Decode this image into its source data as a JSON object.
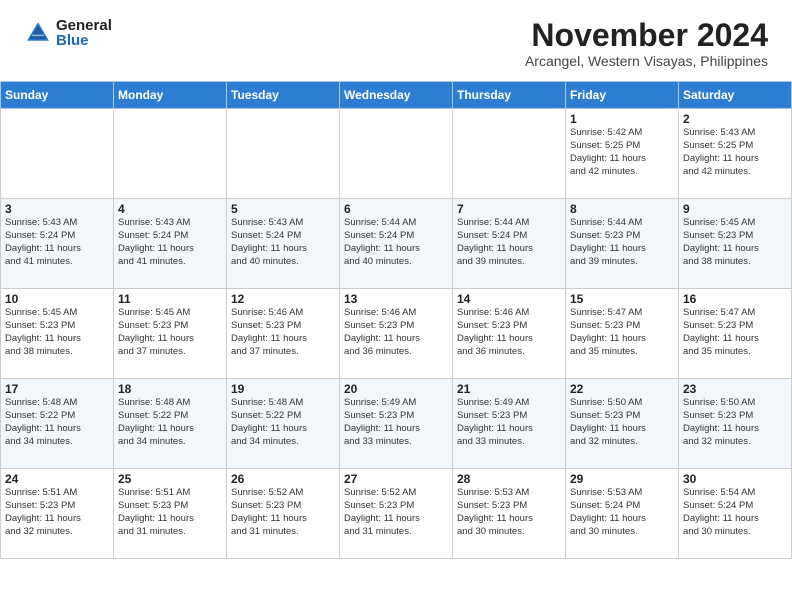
{
  "logo": {
    "general": "General",
    "blue": "Blue"
  },
  "header": {
    "month": "November 2024",
    "location": "Arcangel, Western Visayas, Philippines"
  },
  "weekdays": [
    "Sunday",
    "Monday",
    "Tuesday",
    "Wednesday",
    "Thursday",
    "Friday",
    "Saturday"
  ],
  "weeks": [
    [
      {
        "day": "",
        "info": ""
      },
      {
        "day": "",
        "info": ""
      },
      {
        "day": "",
        "info": ""
      },
      {
        "day": "",
        "info": ""
      },
      {
        "day": "",
        "info": ""
      },
      {
        "day": "1",
        "info": "Sunrise: 5:42 AM\nSunset: 5:25 PM\nDaylight: 11 hours\nand 42 minutes."
      },
      {
        "day": "2",
        "info": "Sunrise: 5:43 AM\nSunset: 5:25 PM\nDaylight: 11 hours\nand 42 minutes."
      }
    ],
    [
      {
        "day": "3",
        "info": "Sunrise: 5:43 AM\nSunset: 5:24 PM\nDaylight: 11 hours\nand 41 minutes."
      },
      {
        "day": "4",
        "info": "Sunrise: 5:43 AM\nSunset: 5:24 PM\nDaylight: 11 hours\nand 41 minutes."
      },
      {
        "day": "5",
        "info": "Sunrise: 5:43 AM\nSunset: 5:24 PM\nDaylight: 11 hours\nand 40 minutes."
      },
      {
        "day": "6",
        "info": "Sunrise: 5:44 AM\nSunset: 5:24 PM\nDaylight: 11 hours\nand 40 minutes."
      },
      {
        "day": "7",
        "info": "Sunrise: 5:44 AM\nSunset: 5:24 PM\nDaylight: 11 hours\nand 39 minutes."
      },
      {
        "day": "8",
        "info": "Sunrise: 5:44 AM\nSunset: 5:23 PM\nDaylight: 11 hours\nand 39 minutes."
      },
      {
        "day": "9",
        "info": "Sunrise: 5:45 AM\nSunset: 5:23 PM\nDaylight: 11 hours\nand 38 minutes."
      }
    ],
    [
      {
        "day": "10",
        "info": "Sunrise: 5:45 AM\nSunset: 5:23 PM\nDaylight: 11 hours\nand 38 minutes."
      },
      {
        "day": "11",
        "info": "Sunrise: 5:45 AM\nSunset: 5:23 PM\nDaylight: 11 hours\nand 37 minutes."
      },
      {
        "day": "12",
        "info": "Sunrise: 5:46 AM\nSunset: 5:23 PM\nDaylight: 11 hours\nand 37 minutes."
      },
      {
        "day": "13",
        "info": "Sunrise: 5:46 AM\nSunset: 5:23 PM\nDaylight: 11 hours\nand 36 minutes."
      },
      {
        "day": "14",
        "info": "Sunrise: 5:46 AM\nSunset: 5:23 PM\nDaylight: 11 hours\nand 36 minutes."
      },
      {
        "day": "15",
        "info": "Sunrise: 5:47 AM\nSunset: 5:23 PM\nDaylight: 11 hours\nand 35 minutes."
      },
      {
        "day": "16",
        "info": "Sunrise: 5:47 AM\nSunset: 5:23 PM\nDaylight: 11 hours\nand 35 minutes."
      }
    ],
    [
      {
        "day": "17",
        "info": "Sunrise: 5:48 AM\nSunset: 5:22 PM\nDaylight: 11 hours\nand 34 minutes."
      },
      {
        "day": "18",
        "info": "Sunrise: 5:48 AM\nSunset: 5:22 PM\nDaylight: 11 hours\nand 34 minutes."
      },
      {
        "day": "19",
        "info": "Sunrise: 5:48 AM\nSunset: 5:22 PM\nDaylight: 11 hours\nand 34 minutes."
      },
      {
        "day": "20",
        "info": "Sunrise: 5:49 AM\nSunset: 5:23 PM\nDaylight: 11 hours\nand 33 minutes."
      },
      {
        "day": "21",
        "info": "Sunrise: 5:49 AM\nSunset: 5:23 PM\nDaylight: 11 hours\nand 33 minutes."
      },
      {
        "day": "22",
        "info": "Sunrise: 5:50 AM\nSunset: 5:23 PM\nDaylight: 11 hours\nand 32 minutes."
      },
      {
        "day": "23",
        "info": "Sunrise: 5:50 AM\nSunset: 5:23 PM\nDaylight: 11 hours\nand 32 minutes."
      }
    ],
    [
      {
        "day": "24",
        "info": "Sunrise: 5:51 AM\nSunset: 5:23 PM\nDaylight: 11 hours\nand 32 minutes."
      },
      {
        "day": "25",
        "info": "Sunrise: 5:51 AM\nSunset: 5:23 PM\nDaylight: 11 hours\nand 31 minutes."
      },
      {
        "day": "26",
        "info": "Sunrise: 5:52 AM\nSunset: 5:23 PM\nDaylight: 11 hours\nand 31 minutes."
      },
      {
        "day": "27",
        "info": "Sunrise: 5:52 AM\nSunset: 5:23 PM\nDaylight: 11 hours\nand 31 minutes."
      },
      {
        "day": "28",
        "info": "Sunrise: 5:53 AM\nSunset: 5:23 PM\nDaylight: 11 hours\nand 30 minutes."
      },
      {
        "day": "29",
        "info": "Sunrise: 5:53 AM\nSunset: 5:24 PM\nDaylight: 11 hours\nand 30 minutes."
      },
      {
        "day": "30",
        "info": "Sunrise: 5:54 AM\nSunset: 5:24 PM\nDaylight: 11 hours\nand 30 minutes."
      }
    ]
  ]
}
